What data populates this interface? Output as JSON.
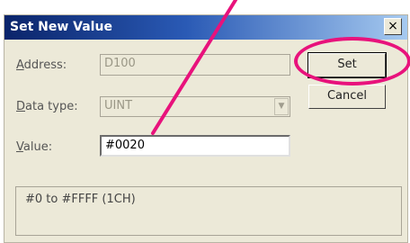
{
  "dialog": {
    "title": "Set New Value",
    "close_glyph": "×"
  },
  "form": {
    "address": {
      "label_mnemonic": "A",
      "label_rest": "ddress:",
      "value": "D100"
    },
    "data_type": {
      "label_mnemonic": "D",
      "label_rest": "ata type:",
      "value": "UINT"
    },
    "value": {
      "label_mnemonic": "V",
      "label_rest": "alue:",
      "value": "#0020"
    }
  },
  "buttons": {
    "set_label": "Set",
    "cancel_label": "Cancel"
  },
  "info": {
    "text": "#0 to #FFFF (1CH)"
  },
  "annotation": {
    "color": "#e8127c",
    "shapes": [
      "pointer-line",
      "highlight-ellipse"
    ]
  }
}
